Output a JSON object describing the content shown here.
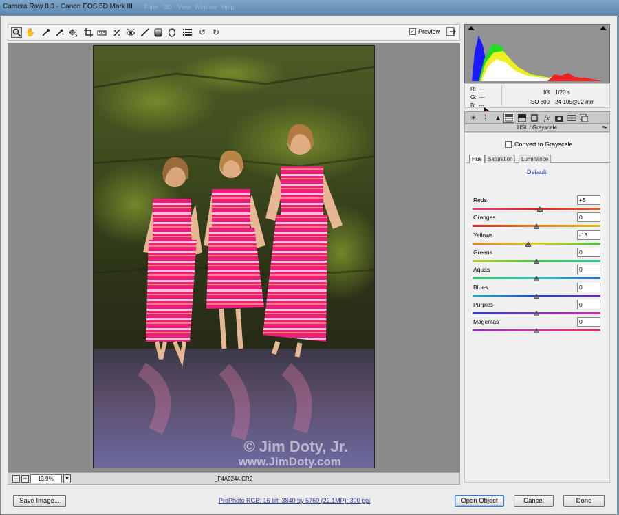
{
  "window": {
    "title": "Camera Raw 8.3  -  Canon EOS 5D Mark III",
    "background_menu_ghost": [
      "Filter",
      "3D",
      "View",
      "Window",
      "Help"
    ]
  },
  "toolbar": {
    "tools": [
      "zoom-tool-icon",
      "hand-tool-icon",
      "white-balance-tool-icon",
      "color-sampler-icon",
      "targeted-adjustment-icon",
      "crop-tool-icon",
      "straighten-tool-icon",
      "spot-removal-icon",
      "red-eye-icon",
      "adjustment-brush-icon",
      "graduated-filter-icon",
      "radial-filter-icon",
      "preferences-icon",
      "rotate-left-icon",
      "rotate-right-icon"
    ],
    "preview_label": "Preview",
    "preview_checked": true
  },
  "photo": {
    "watermark_line1": "© Jim Doty, Jr.",
    "watermark_line2": "www.JimDoty.com"
  },
  "zoom": {
    "minus": "−",
    "plus": "+",
    "value": "13.9%",
    "filename": "_F4A9244.CR2"
  },
  "info": {
    "r_label": "R:",
    "r_value": "---",
    "g_label": "G:",
    "g_value": "---",
    "b_label": "B:",
    "b_value": "---",
    "aperture": "f/8",
    "shutter": "1/20 s",
    "iso": "ISO 800",
    "lens": "24-105@92 mm"
  },
  "panel_tabs": [
    "basic-icon",
    "tone-curve-icon",
    "detail-icon",
    "hsl-grayscale-icon",
    "split-toning-icon",
    "lens-corrections-icon",
    "effects-icon",
    "camera-calibration-icon",
    "presets-icon",
    "snapshots-icon"
  ],
  "panel": {
    "title": "HSL / Grayscale",
    "convert_label": "Convert to Grayscale",
    "convert_checked": false,
    "subtabs": [
      "Hue",
      "Saturation",
      "Luminance"
    ],
    "active_subtab": "Hue",
    "default_link": "Default",
    "sliders": [
      {
        "label": "Reds",
        "value": "+5",
        "num": 5
      },
      {
        "label": "Oranges",
        "value": "0",
        "num": 0
      },
      {
        "label": "Yellows",
        "value": "-13",
        "num": -13
      },
      {
        "label": "Greens",
        "value": "0",
        "num": 0
      },
      {
        "label": "Aquas",
        "value": "0",
        "num": 0
      },
      {
        "label": "Blues",
        "value": "0",
        "num": 0
      },
      {
        "label": "Purples",
        "value": "0",
        "num": 0
      },
      {
        "label": "Magentas",
        "value": "0",
        "num": 0
      }
    ],
    "slider_range": [
      -100,
      100
    ]
  },
  "footer": {
    "save_label": "Save Image...",
    "workflow_text": "ProPhoto RGB; 16 bit; 3840 by 5760 (22.1MP); 300 ppi",
    "open_label": "Open Object",
    "cancel_label": "Cancel",
    "done_label": "Done"
  },
  "colors": {
    "accent_arrow": "#e00000",
    "link": "#2a3ca0"
  }
}
